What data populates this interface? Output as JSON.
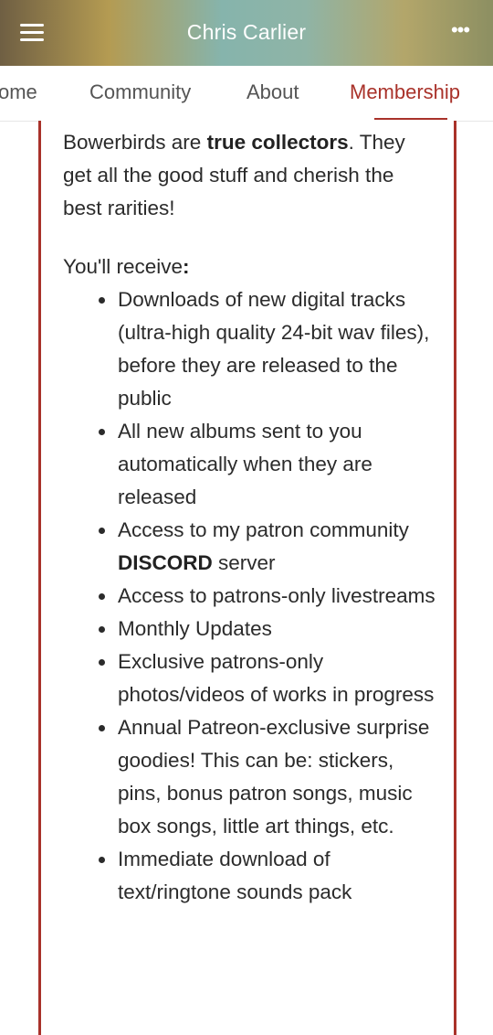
{
  "header": {
    "title": "Chris Carlier",
    "menu_icon": "hamburger-menu-icon",
    "more_icon": "more-dots-icon",
    "more_glyph": "•••"
  },
  "tabs": [
    {
      "label": "ome"
    },
    {
      "label": "Community"
    },
    {
      "label": "About"
    },
    {
      "label": "Membership",
      "active": true
    }
  ],
  "colors": {
    "accent": "#a9322a"
  },
  "content": {
    "intro_start": "Bowerbirds are ",
    "intro_bold": "true collectors",
    "intro_end": ". They get all the good stuff and cherish the best rarities!",
    "receive_label": "You'll receive",
    "receive_colon": ":",
    "benefits": [
      {
        "text": "Downloads of new digital tracks (ultra-high quality 24-bit wav files), before they are released to the public"
      },
      {
        "text": "All new albums sent to you automatically when they are released"
      },
      {
        "pre": "Access to my patron community ",
        "bold": "DISCORD",
        "post": " server"
      },
      {
        "text": "Access to patrons-only livestreams"
      },
      {
        "text": "Monthly Updates"
      },
      {
        "text": "Exclusive patrons-only photos/videos of works in progress"
      },
      {
        "text": "Annual Patreon-exclusive surprise goodies! This can be: stickers, pins, bonus patron songs, music box songs, little art things, etc."
      },
      {
        "text": "Immediate download of text/ringtone sounds pack"
      }
    ]
  }
}
